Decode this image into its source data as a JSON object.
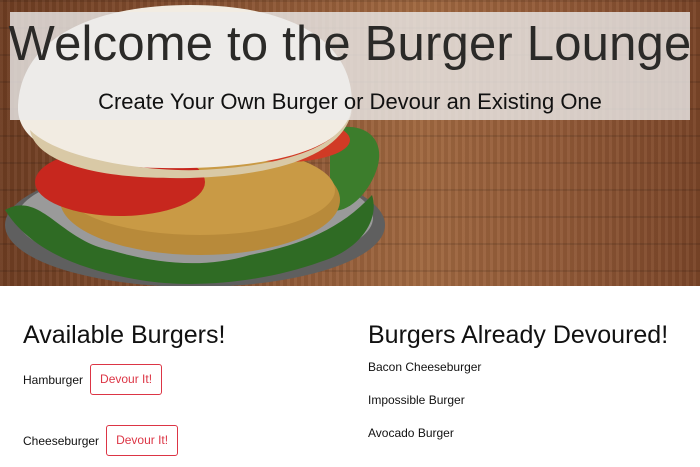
{
  "header": {
    "title": "Welcome to the Burger Lounge",
    "subtitle": "Create Your Own Burger or Devour an Existing One"
  },
  "available": {
    "heading": "Available Burgers!",
    "items": [
      {
        "name": "Hamburger",
        "button_label": "Devour It!"
      },
      {
        "name": "Cheeseburger",
        "button_label": "Devour It!"
      }
    ]
  },
  "devoured": {
    "heading": "Burgers Already Devoured!",
    "items": [
      "Bacon Cheeseburger",
      "Impossible Burger",
      "Avocado Burger"
    ]
  },
  "colors": {
    "button_accent": "#dc3545",
    "banner_bg": "#ebebeb",
    "wood": "#8a5433"
  }
}
